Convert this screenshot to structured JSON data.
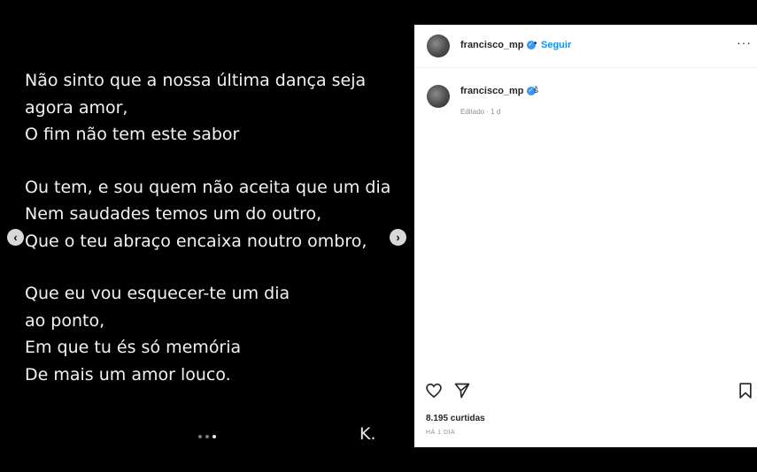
{
  "media": {
    "poem": [
      [
        "Não sinto que a nossa última dança seja",
        "agora amor,",
        "O fim não tem este sabor"
      ],
      [
        "Ou tem, e sou  quem não aceita que um dia",
        "Nem saudades temos um do outro,",
        "Que o  teu abraço encaixa noutro ombro,"
      ],
      [
        "Que eu vou esquecer-te um dia",
        "ao ponto,",
        "Em que tu és só memória",
        "De mais um amor louco."
      ]
    ],
    "signature": "K.",
    "prev_icon": "‹",
    "next_icon": "›"
  },
  "post": {
    "username": "francisco_mp",
    "follow_label": "Seguir",
    "separator": "•",
    "more_label": "···",
    "caption": {
      "username": "francisco_mp",
      "text": "š",
      "edited": "Editado · 1 d"
    },
    "likes": "8.195 curtidas",
    "timestamp": "HÁ 1 DIA"
  },
  "colors": {
    "accent": "#0095f6",
    "verified": "#3897f0",
    "background": "#000000"
  }
}
